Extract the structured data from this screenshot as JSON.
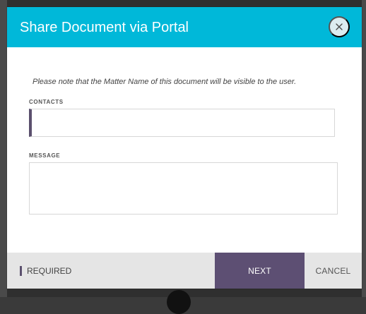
{
  "dialog": {
    "title": "Share Document via Portal",
    "close_icon": "close-icon"
  },
  "body": {
    "notice": "Please note that the Matter Name of this document will be visible to the user.",
    "contacts": {
      "label": "CONTACTS",
      "value": "",
      "placeholder": ""
    },
    "message": {
      "label": "MESSAGE",
      "value": "",
      "placeholder": ""
    }
  },
  "footer": {
    "required_label": "REQUIRED",
    "next_label": "NEXT",
    "cancel_label": "CANCEL"
  },
  "colors": {
    "header": "#00b8d9",
    "accent": "#5b506e",
    "next_button": "#5d4f73",
    "footer": "#e5e5e5",
    "close_button": "#dcecf0"
  }
}
